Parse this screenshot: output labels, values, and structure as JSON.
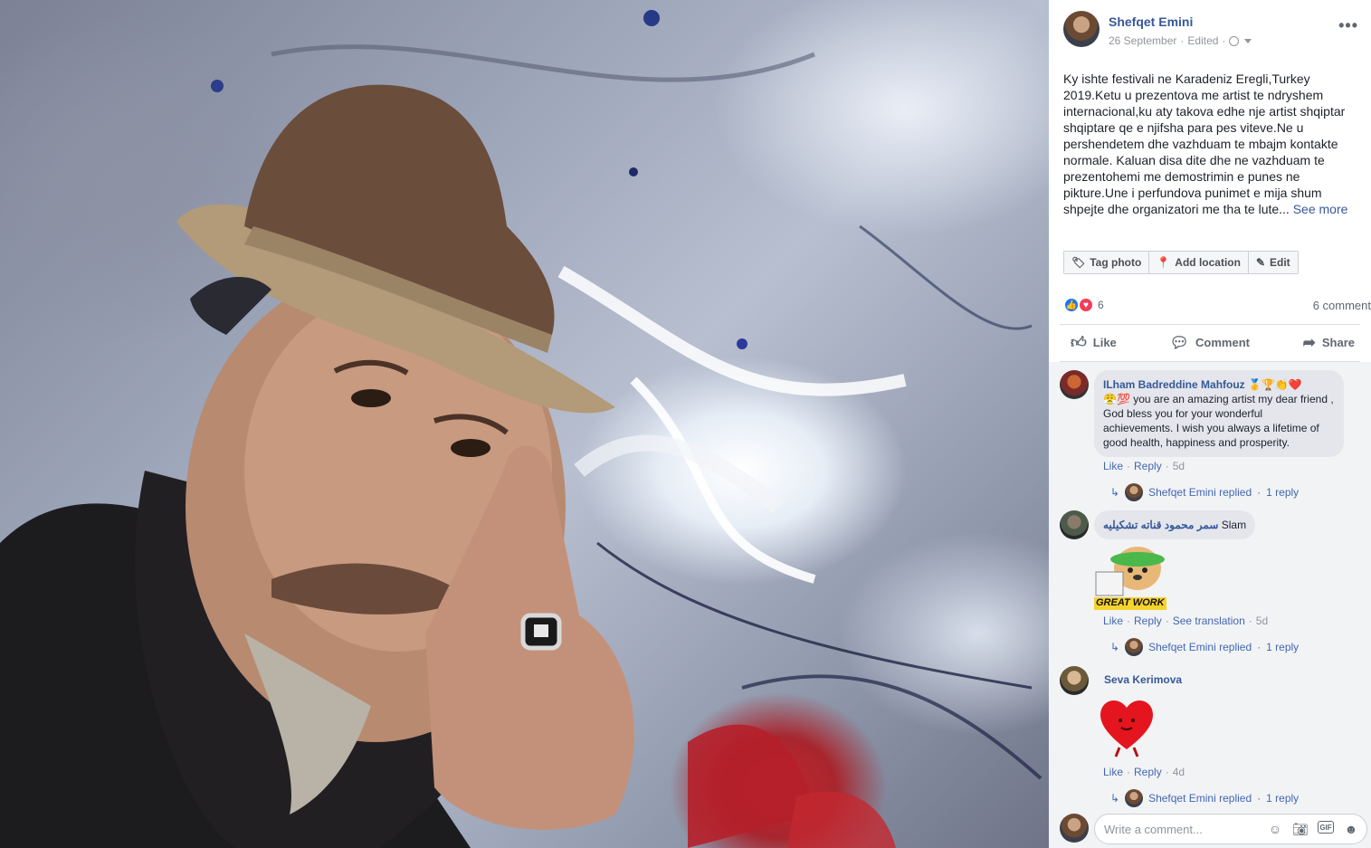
{
  "post": {
    "author": "Shefqet Emini",
    "date": "26 September",
    "edited": "Edited",
    "dot": "·",
    "text": "Ky ishte festivali ne Karadeniz Eregli,Turkey 2019.Ketu u prezentova me artist te ndryshem internacional,ku aty takova edhe nje artist shqiptar shqiptare qe e njifsha para pes viteve.Ne u pershendetem dhe vazhduam te mbajm kontakte normale. Kaluan disa dite dhe ne vazhduam te prezentohemi me demostrimin e punes ne pikture.Une i perfundova punimet e mija shum shpejte dhe organizatori me tha te lute...",
    "see_more": "See more",
    "more_menu": "•••"
  },
  "photo_actions": {
    "tag_photo": "Tag photo",
    "add_location": "Add location",
    "edit": "Edit"
  },
  "reactions": {
    "count": "6",
    "comments": "6 comment"
  },
  "ufi": {
    "like": "Like",
    "comment": "Comment",
    "share": "Share"
  },
  "comments": [
    {
      "name": "ILham Badreddine Mahfouz",
      "name_emoji": "🥇🏆👏❤️",
      "text_emoji": "😤💯",
      "text": " you are an amazing artist my dear friend , God bless you for your wonderful achievements. I wish you always a lifetime of good health, happiness and prosperity.",
      "like": "Like",
      "reply": "Reply",
      "time": "5d",
      "replied_by": "Shefqet Emini replied",
      "reply_count": "1 reply"
    },
    {
      "name": "سمر محمود قناته تشكيليه",
      "text": "Slam",
      "sticker_text": "GREAT WORK",
      "like": "Like",
      "reply": "Reply",
      "translation": "See translation",
      "time": "5d",
      "replied_by": "Shefqet Emini replied",
      "reply_count": "1 reply"
    },
    {
      "name": "Seva Kerimova",
      "like": "Like",
      "reply": "Reply",
      "time": "4d",
      "replied_by": "Shefqet Emini replied",
      "reply_count": "1 reply"
    }
  ],
  "write_comment": {
    "placeholder": "Write a comment..."
  },
  "colors": {
    "link": "#365899",
    "like_blue": "#1877f2",
    "love_red": "#f33e58",
    "comment_bg": "#f2f3f5"
  }
}
